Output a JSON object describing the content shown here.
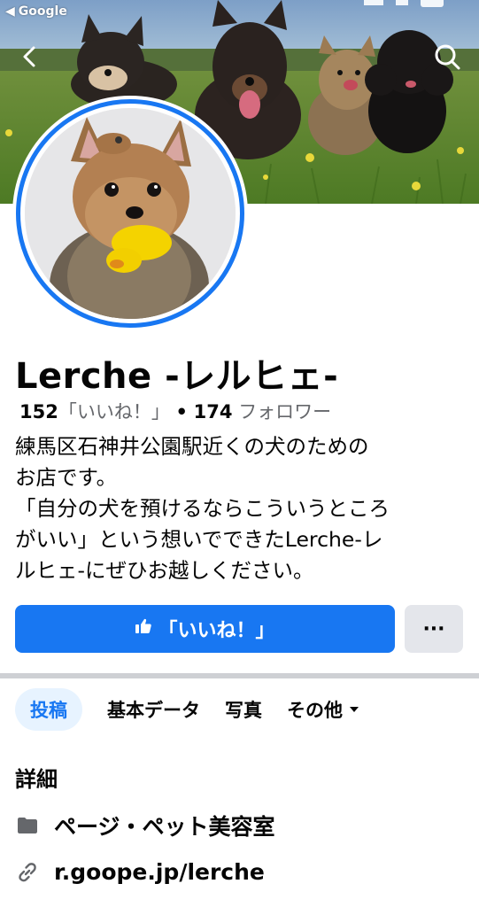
{
  "status_bar": {
    "back_app": "Google"
  },
  "profile": {
    "name": "Lerche -レルヒェ-",
    "likes_count": "152",
    "likes_label": "「いいね！」",
    "separator": "•",
    "followers_count": "174",
    "followers_label": "フォロワー",
    "bio": "練馬区石神井公園駅近くの犬のための\nお店です。\n「自分の犬を預けるならこういうところ\nがいい」という想いでできたLerche-レ\nルヒェ-にぜひお越しください。"
  },
  "actions": {
    "like_label": "「いいね！」",
    "more_label": "···"
  },
  "tabs": [
    {
      "label": "投稿"
    },
    {
      "label": "基本データ"
    },
    {
      "label": "写真"
    },
    {
      "label": "その他"
    }
  ],
  "details": {
    "title": "詳細",
    "category": "ページ・ペット美容室",
    "website": "r.goope.jp/lerche"
  },
  "colors": {
    "brand": "#1877f2",
    "secondary_button": "#e4e6eb",
    "active_tab_bg": "#e7f3ff",
    "muted_text": "#65676b"
  },
  "icons": [
    "back-arrow-icon",
    "chevron-left-icon",
    "search-icon",
    "thumbs-up-icon",
    "more-dots-icon",
    "caret-down-icon",
    "category-icon",
    "link-icon"
  ]
}
